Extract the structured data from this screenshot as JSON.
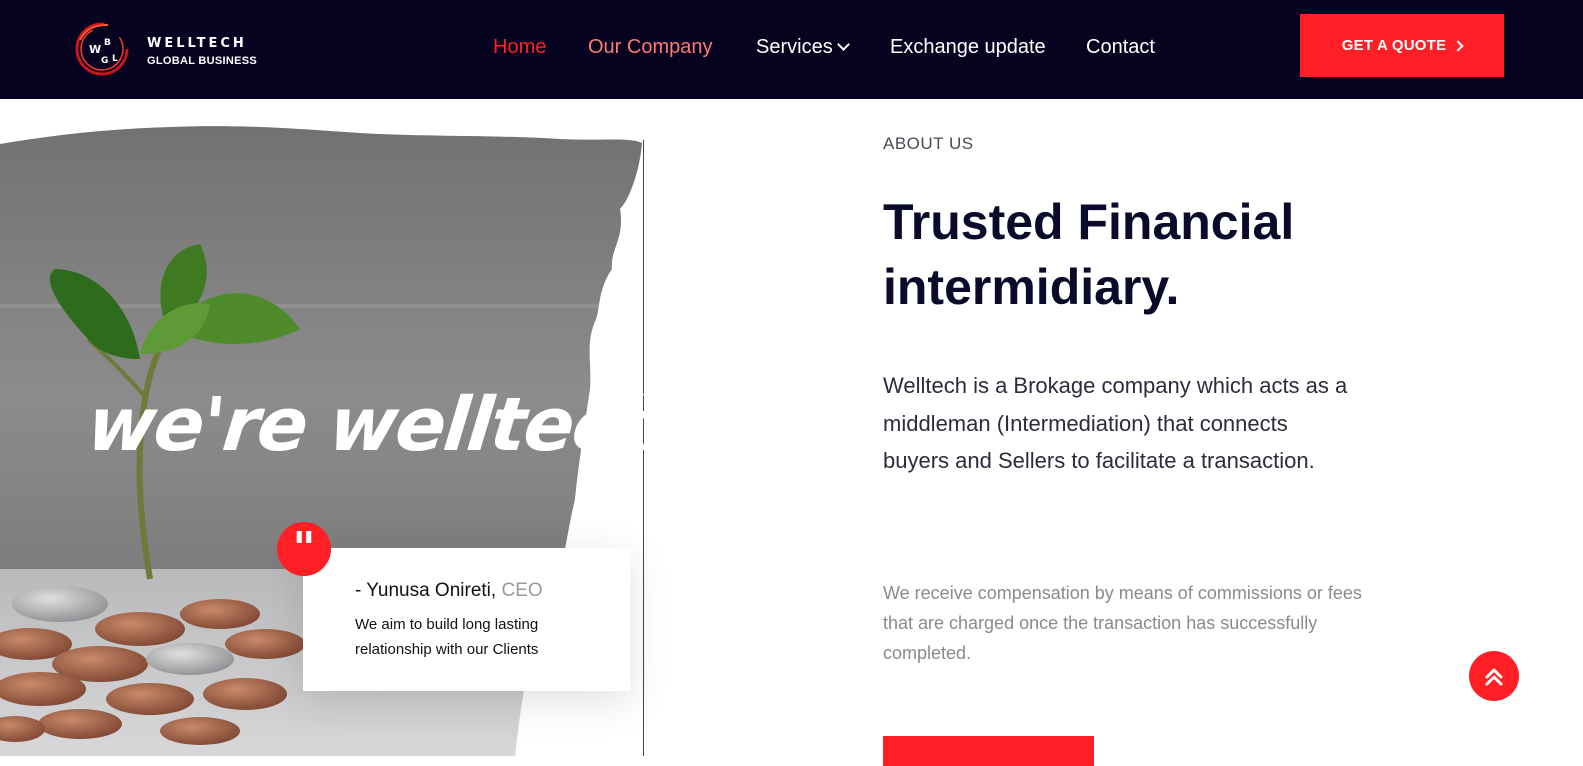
{
  "brand": {
    "logo_letters": "WBGL",
    "name": "WELLTECH",
    "tagline": "GLOBAL BUSINESS"
  },
  "nav": {
    "items": [
      {
        "label": "Home"
      },
      {
        "label": "Our Company"
      },
      {
        "label": "Services"
      },
      {
        "label": "Exchange update"
      },
      {
        "label": "Contact"
      }
    ],
    "cta_label": "GET A QUOTE"
  },
  "hero": {
    "overlay_text": "we're welltech",
    "quote": {
      "name": "- Yunusa Onireti,",
      "role": "CEO",
      "text": "We aim to build long lasting relationship with our Clients"
    }
  },
  "about": {
    "eyebrow": "ABOUT US",
    "headline": "Trusted Financial intermidiary.",
    "paragraph1": "Welltech is a Brokage company which acts as a middleman (Intermediation) that connects buyers and Sellers to facilitate a transaction.",
    "paragraph2": "We receive compensation by means of commissions or fees that are charged once the transaction has successfully completed."
  },
  "colors": {
    "header_bg": "#05031f",
    "accent": "#ff1f24",
    "nav_active": "#ff2020",
    "nav_company": "#ff7a73",
    "headline": "#0a0a2a"
  },
  "icons": [
    "chevron-down-icon",
    "chevron-right-icon",
    "quote-icon",
    "double-chevron-up-icon"
  ]
}
